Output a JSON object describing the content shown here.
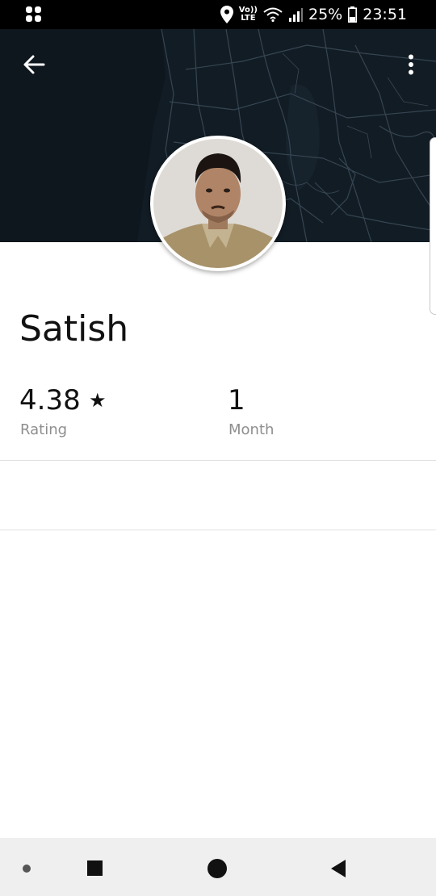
{
  "status_bar": {
    "battery_percent": "25%",
    "time": "23:51",
    "network_label_top": "Vo))",
    "network_label_bottom": "LTE",
    "icons": [
      "apps-icon",
      "location-icon",
      "wifi-icon",
      "signal-icon",
      "battery-icon"
    ]
  },
  "header": {
    "back_icon": "arrow-left-icon",
    "menu_icon": "more-vertical-icon",
    "background": "map"
  },
  "profile": {
    "name": "Satish",
    "rating_value": "4.38",
    "rating_star": "★",
    "rating_label": "Rating",
    "tenure_value": "1",
    "tenure_label": "Month"
  },
  "nav_bar": {
    "icons": [
      "nav-dot-icon",
      "recents-icon",
      "home-icon",
      "back-icon"
    ]
  },
  "colors": {
    "header_bg": "#121c24",
    "map_lines": "#3a4a58",
    "label_gray": "#8e8e8e"
  }
}
